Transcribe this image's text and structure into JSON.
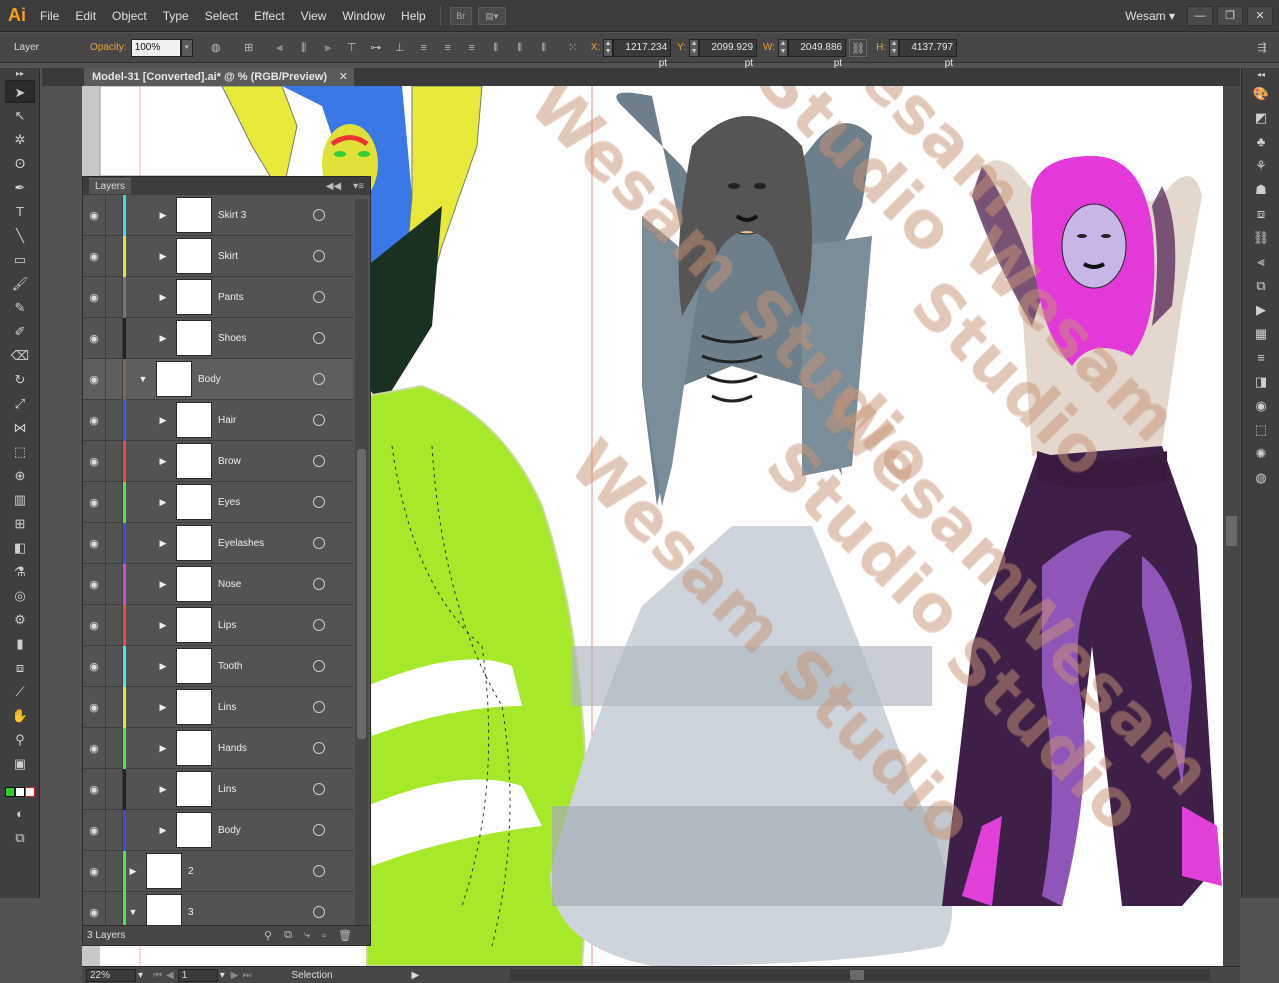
{
  "app": {
    "logo": "Ai"
  },
  "menu": [
    "File",
    "Edit",
    "Object",
    "Type",
    "Select",
    "Effect",
    "View",
    "Window",
    "Help"
  ],
  "menu_buttons": {
    "bridge": "Br",
    "arrange": "▤▾"
  },
  "workspace": {
    "name": "Wesam",
    "caret": "▾"
  },
  "window_controls": {
    "minimize": "—",
    "restore": "❐",
    "close": "✕"
  },
  "control_bar": {
    "selection_label": "Layer",
    "opacity_label": "Opacity:",
    "opacity_value": "100%",
    "x_label": "X:",
    "x_value": "1217.234 pt",
    "y_label": "Y:",
    "y_value": "2099.929 pt",
    "w_label": "W:",
    "w_value": "2049.886 pt",
    "h_label": "H:",
    "h_value": "4137.797 pt"
  },
  "document": {
    "tab_title": "Model-31 [Converted].ai* @ % (RGB/Preview)",
    "close": "✕"
  },
  "layers_panel": {
    "title": "Layers",
    "collapse": "◀◀",
    "menu": "▾≡",
    "footer_count": "3 Layers",
    "rows": [
      {
        "name": "Skirt 3",
        "color": "#4ad6e8",
        "twist": "▶",
        "indent": 1
      },
      {
        "name": "Skirt",
        "color": "#e8e24a",
        "twist": "▶",
        "indent": 1
      },
      {
        "name": "Pants",
        "color": "#777777",
        "twist": "▶",
        "indent": 1
      },
      {
        "name": "Shoes",
        "color": "#222222",
        "twist": "▶",
        "indent": 1
      },
      {
        "name": "Body",
        "color": "#7a6a5a",
        "twist": "▼",
        "indent": 0
      },
      {
        "name": "Hair",
        "color": "#3a5ae8",
        "twist": "▶",
        "indent": 1
      },
      {
        "name": "Brow",
        "color": "#e84a4a",
        "twist": "▶",
        "indent": 1
      },
      {
        "name": "Eyes",
        "color": "#4ae84a",
        "twist": "▶",
        "indent": 1
      },
      {
        "name": "Eyelashes",
        "color": "#4a4ad6",
        "twist": "▶",
        "indent": 1
      },
      {
        "name": "Nose",
        "color": "#d64ad6",
        "twist": "▶",
        "indent": 1
      },
      {
        "name": "Lips",
        "color": "#e84a4a",
        "twist": "▶",
        "indent": 1
      },
      {
        "name": "Tooth",
        "color": "#4ae8e8",
        "twist": "▶",
        "indent": 1
      },
      {
        "name": "Lins",
        "color": "#e8e24a",
        "twist": "▶",
        "indent": 1
      },
      {
        "name": "Hands",
        "color": "#4ae84a",
        "twist": "▶",
        "indent": 1
      },
      {
        "name": "Lins",
        "color": "#222222",
        "twist": "▶",
        "indent": 1
      },
      {
        "name": "Body",
        "color": "#4a4ad6",
        "twist": "▶",
        "indent": 1
      },
      {
        "name": "2",
        "color": "#4ae84a",
        "twist": "▶",
        "indent": -1
      },
      {
        "name": "3",
        "color": "#4ae84a",
        "twist": "▼",
        "indent": -1
      }
    ]
  },
  "status": {
    "zoom": "22%",
    "artboard": "1",
    "tool": "Selection"
  },
  "watermark": "Wesam Studio"
}
